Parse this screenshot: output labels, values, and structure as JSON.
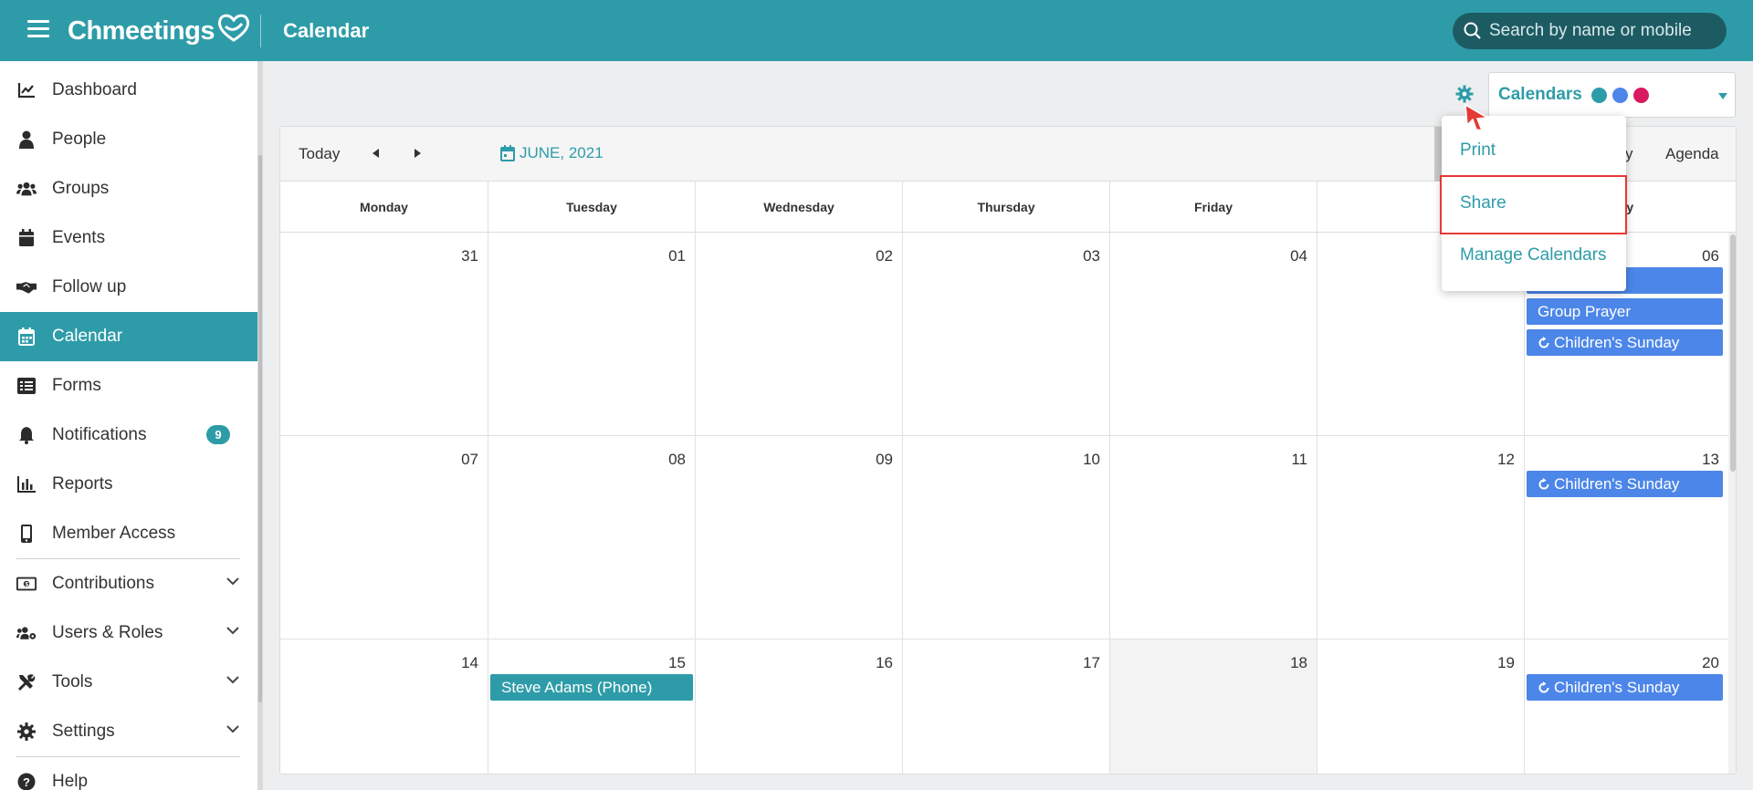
{
  "app": {
    "brand": "Chmeetings",
    "page_title": "Calendar",
    "search_placeholder": "Search by name or mobile"
  },
  "sidebar": {
    "items": [
      {
        "label": "Dashboard",
        "icon": "chart-line-icon"
      },
      {
        "label": "People",
        "icon": "person-icon"
      },
      {
        "label": "Groups",
        "icon": "users-icon"
      },
      {
        "label": "Events",
        "icon": "calendar-icon"
      },
      {
        "label": "Follow up",
        "icon": "handshake-icon"
      },
      {
        "label": "Calendar",
        "icon": "calendar-grid-icon",
        "active": true
      },
      {
        "label": "Forms",
        "icon": "list-icon"
      },
      {
        "label": "Notifications",
        "icon": "bell-icon",
        "badge": "9"
      },
      {
        "label": "Reports",
        "icon": "bar-chart-icon"
      },
      {
        "label": "Member Access",
        "icon": "mobile-icon"
      },
      {
        "label": "Contributions",
        "icon": "money-icon",
        "expandable": true
      },
      {
        "label": "Users & Roles",
        "icon": "users-cog-icon",
        "expandable": true
      },
      {
        "label": "Tools",
        "icon": "tools-icon",
        "expandable": true
      },
      {
        "label": "Settings",
        "icon": "gear-icon",
        "expandable": true
      },
      {
        "label": "Help",
        "icon": "question-circle-icon"
      }
    ]
  },
  "calendar_selector": {
    "label": "Calendars",
    "colors": [
      "#2e9ca8",
      "#4c86e8",
      "#d81b60"
    ]
  },
  "toolbar": {
    "today": "Today",
    "month_label": "JUNE, 2021",
    "view_partial": "y",
    "agenda": "Agenda"
  },
  "weekdays": [
    "Monday",
    "Tuesday",
    "Wednesday",
    "Thursday",
    "Friday",
    "Saturd",
    "day"
  ],
  "weeks": [
    {
      "days": [
        "31",
        "01",
        "02",
        "03",
        "04",
        "",
        "06"
      ]
    },
    {
      "days": [
        "07",
        "08",
        "09",
        "10",
        "11",
        "12",
        "13"
      ]
    },
    {
      "days": [
        "14",
        "15",
        "16",
        "17",
        "18",
        "19",
        "20"
      ]
    }
  ],
  "events": [
    {
      "week": 0,
      "day": 6,
      "slot": 0,
      "title": "",
      "color": "blue",
      "recurring": false
    },
    {
      "week": 0,
      "day": 6,
      "slot": 1,
      "title": "Group Prayer",
      "color": "blue",
      "recurring": false
    },
    {
      "week": 0,
      "day": 6,
      "slot": 2,
      "title": "Children's Sunday",
      "color": "blue",
      "recurring": true
    },
    {
      "week": 1,
      "day": 6,
      "slot": 0,
      "title": "Children's Sunday",
      "color": "blue",
      "recurring": true
    },
    {
      "week": 2,
      "day": 1,
      "slot": 0,
      "title": "Steve Adams (Phone)",
      "color": "teal",
      "recurring": false
    },
    {
      "week": 2,
      "day": 6,
      "slot": 0,
      "title": "Children's Sunday",
      "color": "blue",
      "recurring": true
    }
  ],
  "settings_menu": {
    "items": [
      "Print",
      "Share",
      "Manage Calendars"
    ],
    "highlighted": "Share"
  }
}
